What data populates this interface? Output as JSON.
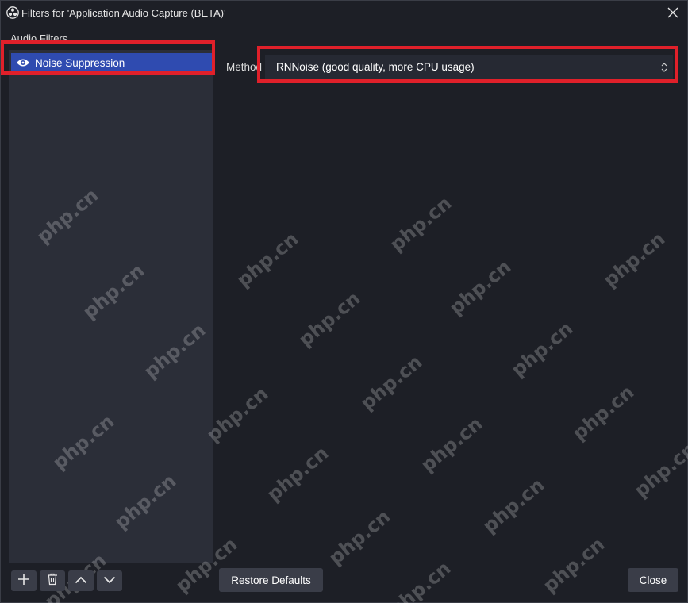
{
  "window": {
    "title": "Filters for 'Application Audio Capture (BETA)'",
    "app_icon": "obs-logo-icon",
    "close_icon": "close-icon"
  },
  "filters_panel": {
    "title": "Audio Filters",
    "items": [
      {
        "label": "Noise Suppression",
        "icon": "eye-icon",
        "selected": true
      }
    ]
  },
  "properties": {
    "method_label": "Method",
    "method_value": "RNNoise (good quality, more CPU usage)"
  },
  "toolbar": {
    "add_icon": "plus-icon",
    "remove_icon": "trash-icon",
    "move_up_icon": "chevron-up-icon",
    "move_down_icon": "chevron-down-icon",
    "restore_defaults_label": "Restore Defaults",
    "close_label": "Close"
  },
  "watermark_text": "php.cn",
  "colors": {
    "background": "#1d1f26",
    "list_background": "#2b2e38",
    "selection": "#2f4bb0",
    "highlight": "#e0202a",
    "button": "#3a3d48"
  }
}
